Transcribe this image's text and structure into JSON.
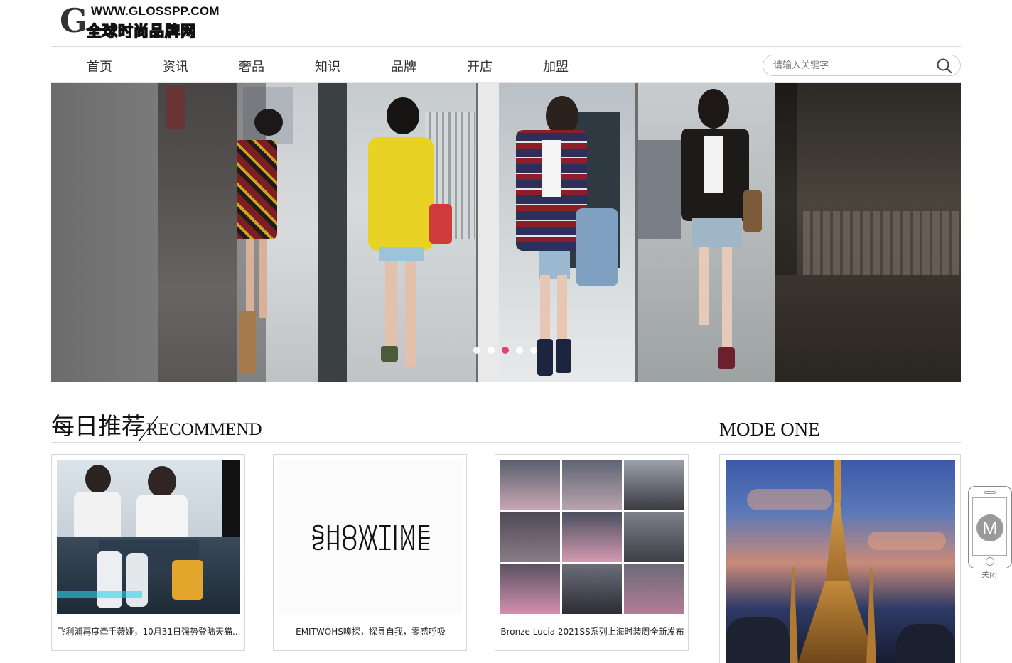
{
  "logo": {
    "url_text": "WWW.GLOSSPP.COM",
    "name_text": "全球时尚品牌网",
    "mark": "G"
  },
  "nav": {
    "items": [
      "首页",
      "资讯",
      "奢品",
      "知识",
      "品牌",
      "开店",
      "加盟"
    ]
  },
  "search": {
    "placeholder": "请输入关键字",
    "icon": "search-icon"
  },
  "banner": {
    "slide_count": 5,
    "active_slide_index": 2
  },
  "recommend": {
    "title_cn": "每日推荐",
    "title_en": "RECOMMEND"
  },
  "mode": {
    "title": "MODE ONE"
  },
  "cards": [
    {
      "caption": "飞利浦再度牵手薇娅，10月31日强势登陆天猫..."
    },
    {
      "caption": "EMITWOHS嗅探，探寻自我，零感呼吸",
      "logo_text": "SHOWTIME"
    },
    {
      "caption": "Bronze Lucia 2021SS系列上海时装周全新发布"
    }
  ],
  "widget": {
    "letter": "M",
    "close_label": "关闭"
  },
  "colors": {
    "active_dot": "#e0456f",
    "border": "#d6d6d6"
  }
}
